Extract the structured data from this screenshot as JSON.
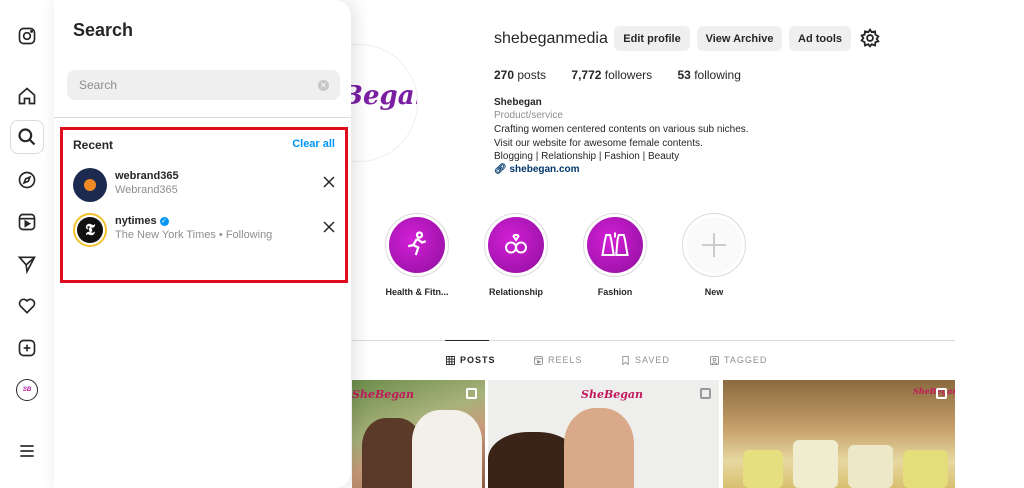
{
  "nav": {
    "items": [
      "instagram-logo",
      "home",
      "search",
      "explore",
      "reels",
      "messages",
      "notifications",
      "create",
      "profile",
      "more"
    ]
  },
  "search": {
    "title": "Search",
    "placeholder": "Search",
    "recent_label": "Recent",
    "clear_all": "Clear all",
    "recent": [
      {
        "username": "webrand365",
        "subtitle": "Webrand365",
        "verified": false
      },
      {
        "username": "nytimes",
        "subtitle": "The New York Times • Following",
        "verified": true
      }
    ]
  },
  "profile": {
    "username": "shebeganmedia",
    "logo_text": "Began",
    "buttons": {
      "edit": "Edit profile",
      "archive": "View Archive",
      "ad_tools": "Ad tools"
    },
    "stats": {
      "posts_count": "270",
      "posts_label": "posts",
      "followers_count": "7,772",
      "followers_label": "followers",
      "following_count": "53",
      "following_label": "following"
    },
    "bio": {
      "name": "Shebegan",
      "category": "Product/service",
      "lines": [
        "Crafting women centered contents on various sub niches.",
        "Visit our website for awesome female contents.",
        "Blogging | Relationship | Fashion | Beauty"
      ],
      "link": "shebegan.com"
    },
    "highlights": [
      {
        "label": "Health & Fitn..."
      },
      {
        "label": "Relationship"
      },
      {
        "label": "Fashion"
      },
      {
        "label": "New"
      }
    ],
    "tabs": [
      "POSTS",
      "REELS",
      "SAVED",
      "TAGGED"
    ],
    "posts": [
      {
        "brand": "SheBegan"
      },
      {
        "brand": "SheBegan"
      },
      {
        "brand": "SheBegan"
      }
    ]
  },
  "colors": {
    "accent": "#0095f6",
    "highlight_box": "#e00b1c",
    "brand": "#b5179e"
  }
}
